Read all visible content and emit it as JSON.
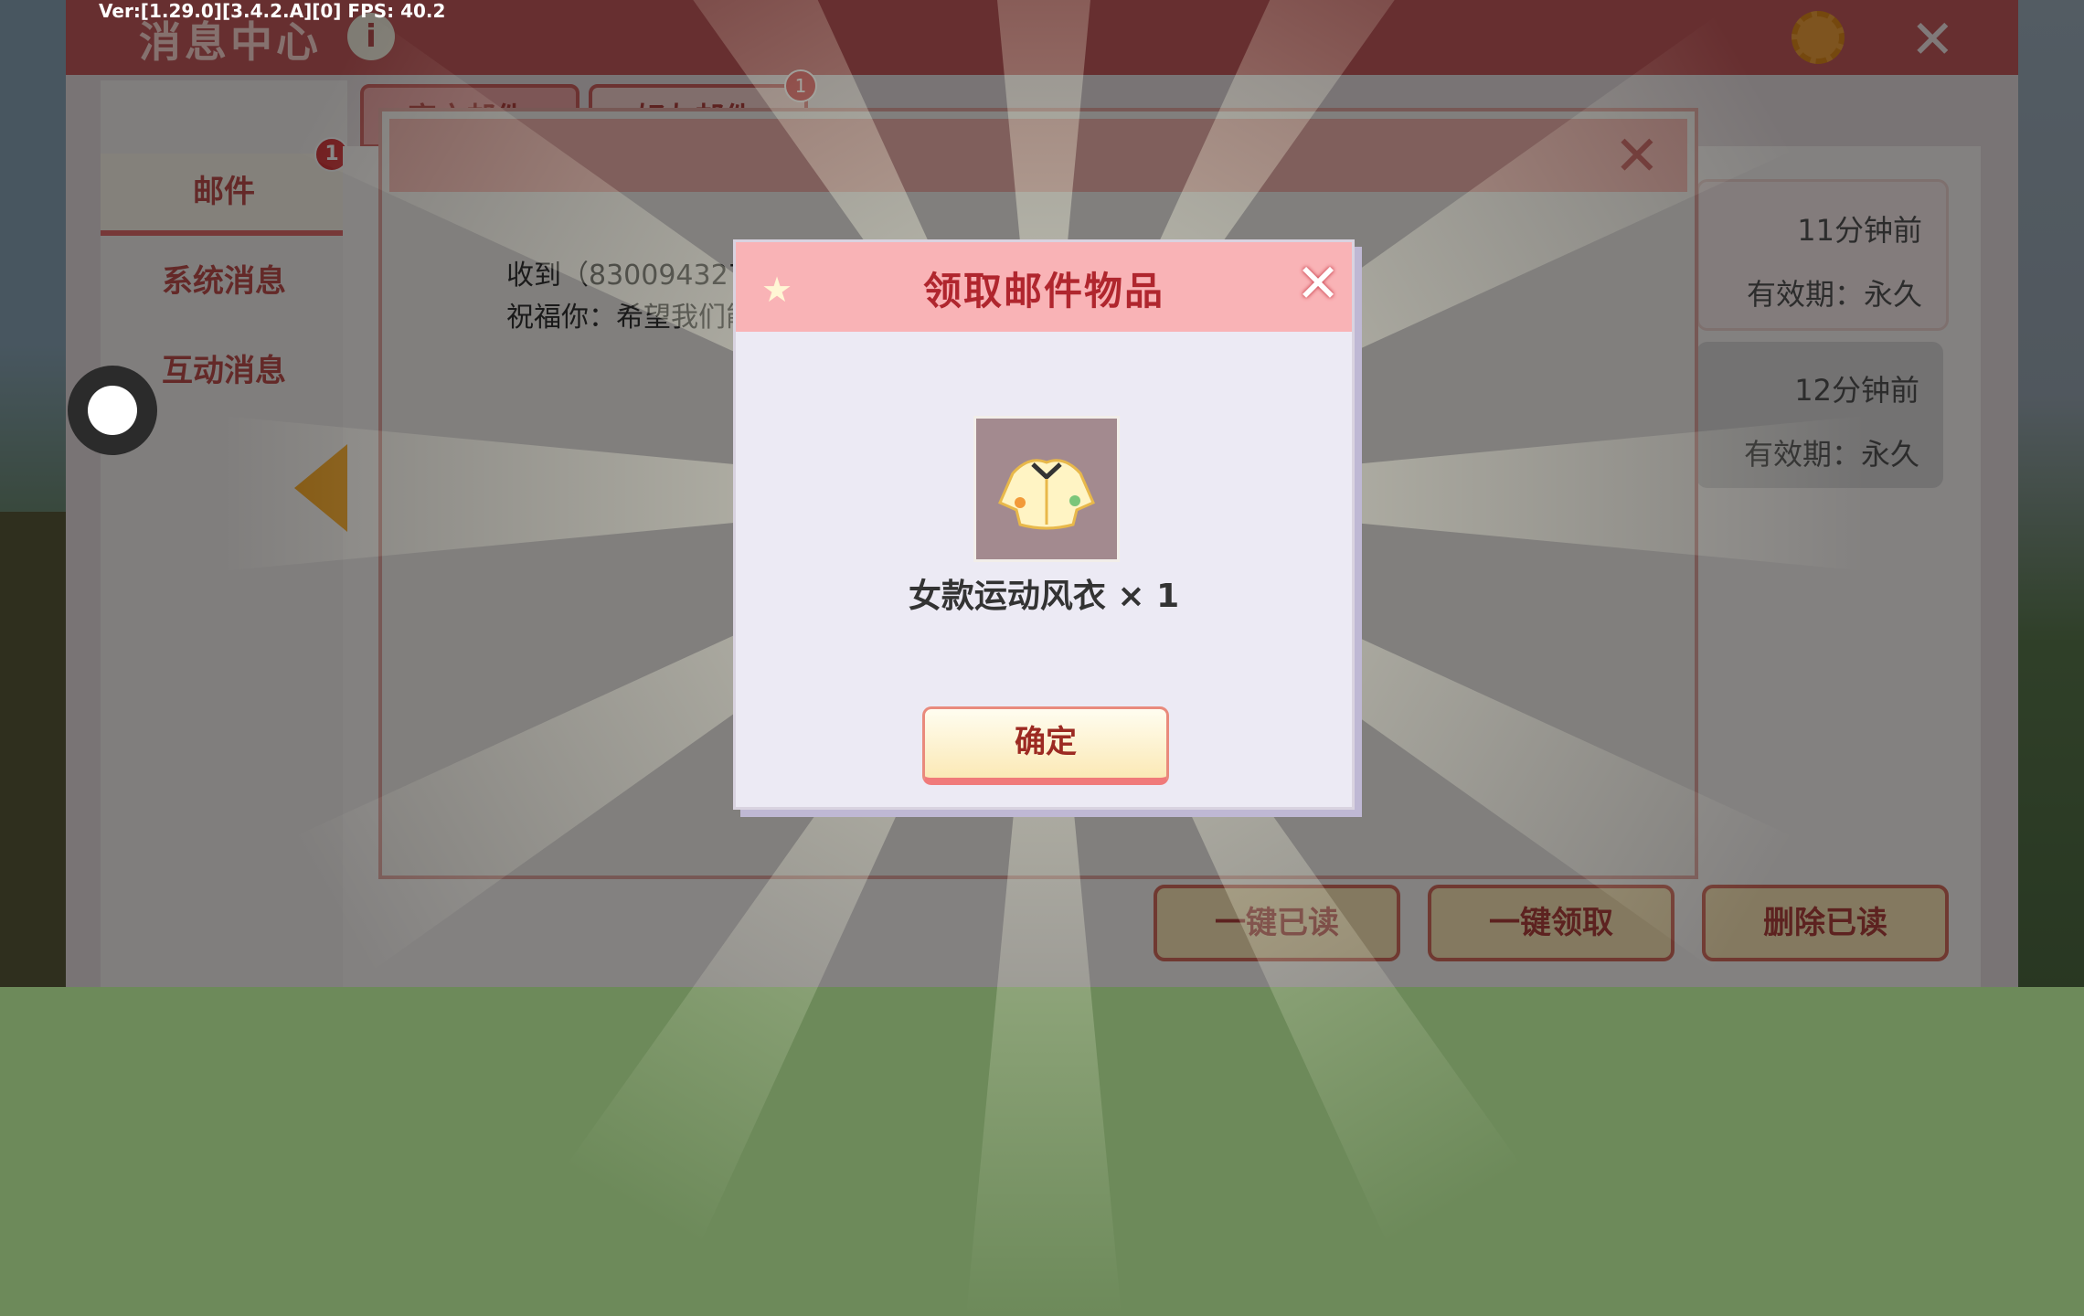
{
  "debug": {
    "version": "Ver:[1.29.0][3.4.2.A][0] FPS: 40.2"
  },
  "message_center": {
    "title": "消息中心",
    "info_label": "i",
    "nav": [
      {
        "label": "邮件",
        "badge": "1"
      },
      {
        "label": "系统消息"
      },
      {
        "label": "互动消息"
      }
    ],
    "tabs": [
      {
        "label": "官方邮件"
      },
      {
        "label": "好友邮件",
        "badge": "1"
      }
    ],
    "mails": [
      {
        "time": "11分钟前",
        "expiry": "有效期：永久"
      },
      {
        "time": "12分钟前",
        "expiry": "有效期：永久"
      }
    ],
    "actions": {
      "read_all": "一键已读",
      "claim_all": "一键领取",
      "delete_read": "删除已读"
    }
  },
  "mail_detail": {
    "line1": "收到（830094327）",
    "line2": "祝福你：希望我们能"
  },
  "reward_dialog": {
    "title": "领取邮件物品",
    "item_name": "女款运动风衣 × 1",
    "confirm_label": "确定"
  },
  "colors": {
    "accent": "#c0504d",
    "dialog_header": "#f9b3b6",
    "button_fill": "#fbe9b6"
  }
}
